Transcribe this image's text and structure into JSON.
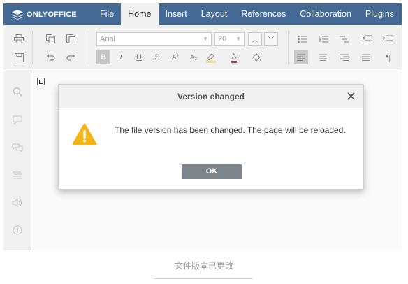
{
  "app": {
    "logo_text": "ONLYOFFICE",
    "tabs": [
      "File",
      "Home",
      "Insert",
      "Layout",
      "References",
      "Collaboration",
      "Plugins"
    ],
    "active_tab": "Home"
  },
  "toolbar": {
    "font_name": "Arial",
    "font_size": "20",
    "superscript": "A²",
    "subscript": "A₂",
    "bold": "B",
    "italic": "I",
    "underline": "U",
    "strikethrough": "S",
    "font_color": "A",
    "paragraph_mark": "¶"
  },
  "dialog": {
    "title": "Version changed",
    "close_glyph": "✕",
    "message": "The file version has been changed. The page will be reloaded.",
    "ok_label": "OK"
  },
  "caption": "文件版本已更改",
  "colors": {
    "header_bg": "#446995",
    "toolbar_bg": "#f1f1f1",
    "warning": "#f4b514",
    "ok_button": "#7d858c"
  }
}
